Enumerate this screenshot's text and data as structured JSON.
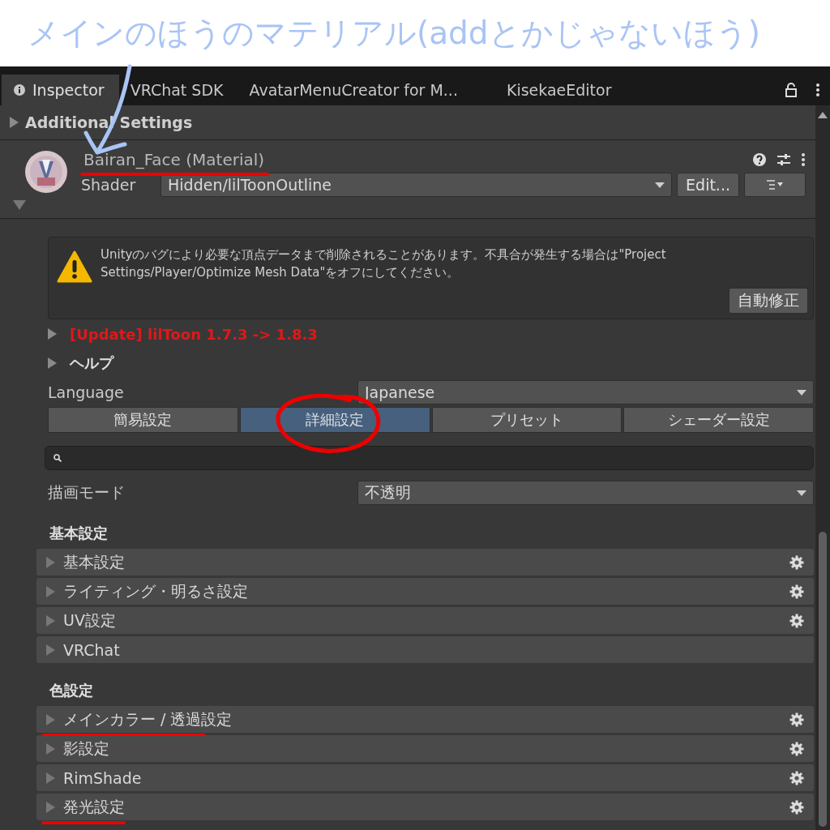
{
  "annotation": {
    "text": "メインのほうのマテリアル(addとかじゃないほう)"
  },
  "tabs": [
    {
      "label": "Inspector",
      "icon": true,
      "selected": true
    },
    {
      "label": "VRChat SDK",
      "icon": false,
      "selected": false
    },
    {
      "label": "AvatarMenuCreator for M...",
      "icon": false,
      "selected": false
    },
    {
      "label": "KisekaeEditor",
      "icon": false,
      "selected": false
    }
  ],
  "additional_settings": {
    "label": "Additional Settings",
    "expanded": false
  },
  "material": {
    "name": "Bairan_Face (Material)",
    "underlined": true,
    "shader_label": "Shader",
    "shader": "Hidden/lilToonOutline",
    "edit_button": "Edit..."
  },
  "warning": {
    "text": "Unityのバグにより必要な頂点データまで削除されることがあります。不具合が発生する場合は\"Project Settings/Player/Optimize Mesh Data\"をオフにしてください。",
    "button": "自動修正"
  },
  "update": {
    "label": "[Update] lilToon 1.7.3 -> 1.8.3"
  },
  "help": {
    "label": "ヘルプ"
  },
  "language": {
    "label": "Language",
    "value": "Japanese"
  },
  "mode_tabs": [
    {
      "label": "簡易設定",
      "selected": false,
      "circled": false
    },
    {
      "label": "詳細設定",
      "selected": true,
      "circled": true
    },
    {
      "label": "プリセット",
      "selected": false,
      "circled": false
    },
    {
      "label": "シェーダー設定",
      "selected": false,
      "circled": false
    }
  ],
  "render_mode": {
    "label": "描画モード",
    "value": "不透明"
  },
  "sections": [
    {
      "title": "基本設定",
      "items": [
        {
          "label": "基本設定",
          "gear": true,
          "underlined": false
        },
        {
          "label": "ライティング・明るさ設定",
          "gear": true,
          "underlined": false
        },
        {
          "label": "UV設定",
          "gear": true,
          "underlined": false
        },
        {
          "label": "VRChat",
          "gear": false,
          "underlined": false
        }
      ]
    },
    {
      "title": "色設定",
      "items": [
        {
          "label": "メインカラー / 透過設定",
          "gear": true,
          "underlined": true
        },
        {
          "label": "影設定",
          "gear": true,
          "underlined": false
        },
        {
          "label": "RimShade",
          "gear": true,
          "underlined": false
        },
        {
          "label": "発光設定",
          "gear": true,
          "underlined": true
        }
      ]
    }
  ]
}
